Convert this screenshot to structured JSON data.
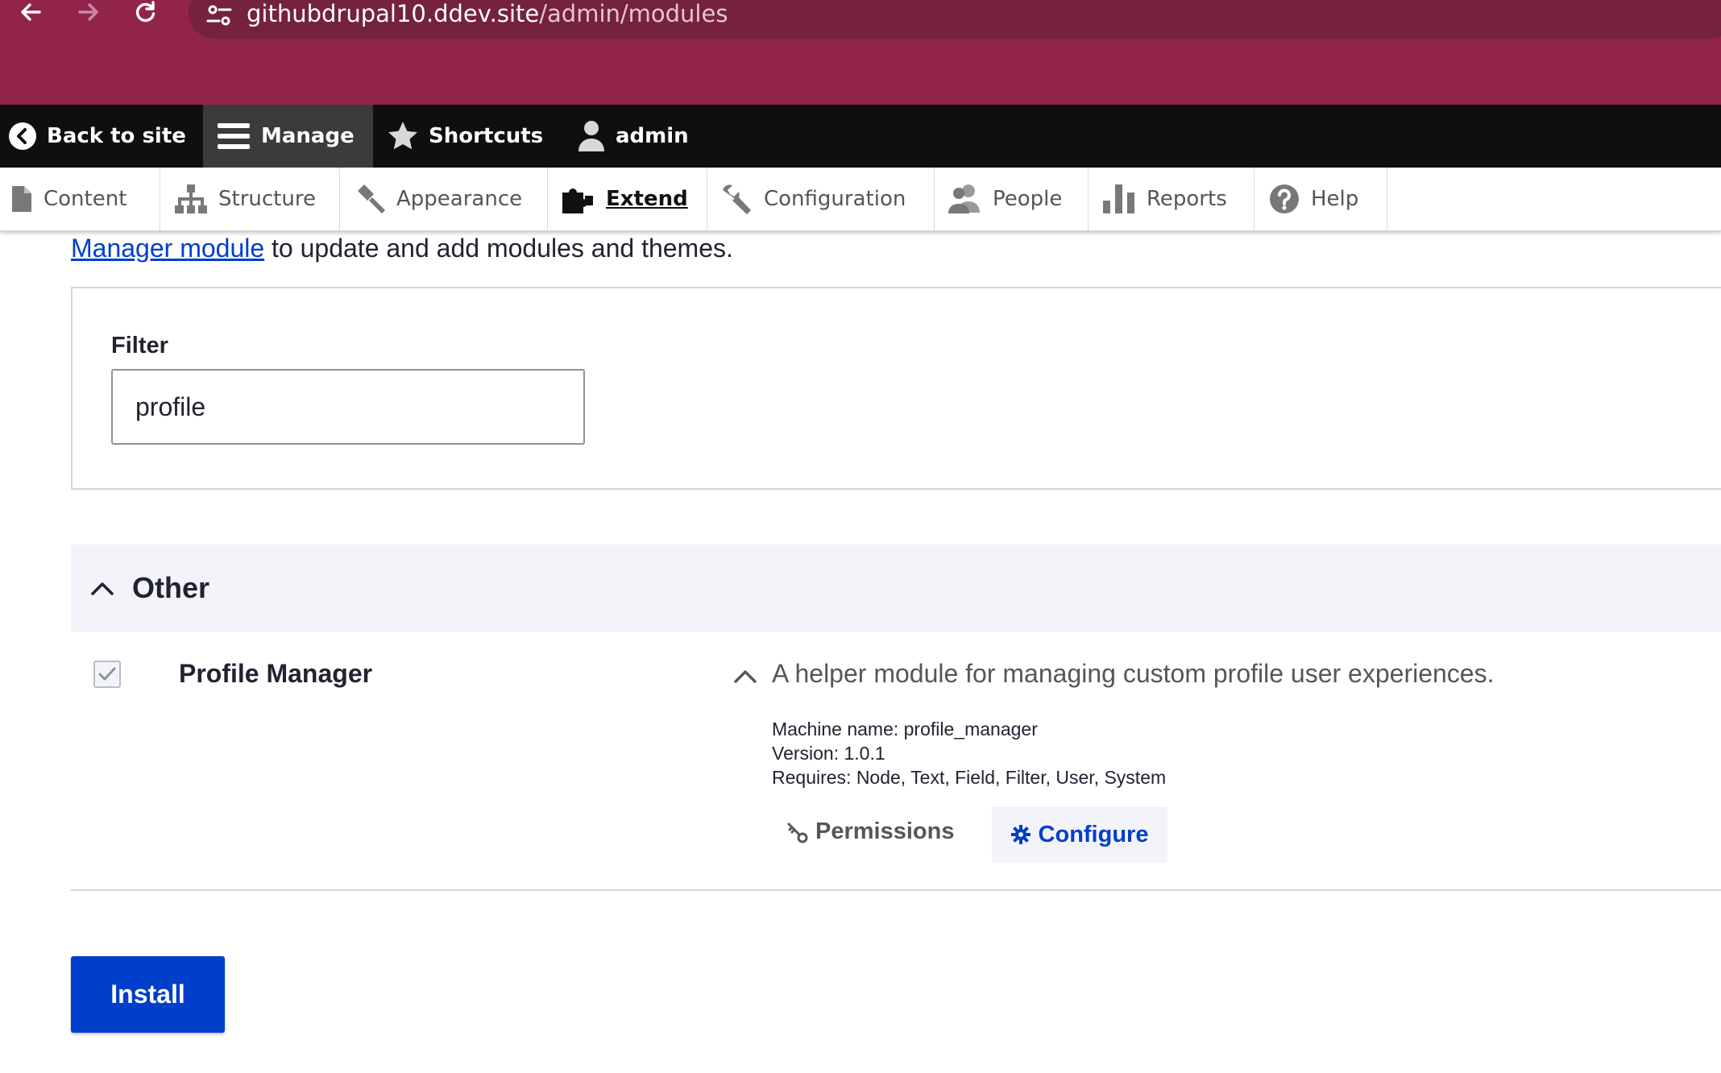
{
  "browser": {
    "url_host": "githubdrupal10.ddev.site",
    "url_path": "/admin/modules",
    "icons": [
      "back-arrow-icon",
      "forward-arrow-icon",
      "reload-icon",
      "site-info-icon"
    ]
  },
  "toolbar": {
    "back_to_site": "Back to site",
    "manage": "Manage",
    "shortcuts": "Shortcuts",
    "user": "admin"
  },
  "tray": {
    "items": [
      "Content",
      "Structure",
      "Appearance",
      "Extend",
      "Configuration",
      "People",
      "Reports",
      "Help"
    ],
    "active": "Extend"
  },
  "intro": {
    "link_text": "Manager module",
    "text": " to update and add modules and themes."
  },
  "filter": {
    "label": "Filter",
    "value": "profile"
  },
  "package": {
    "title": "Other"
  },
  "module": {
    "name": "Profile Manager",
    "checked": true,
    "description": "A helper module for managing custom profile user experiences.",
    "machine_name": "Machine name: profile_manager",
    "version": "Version: 1.0.1",
    "requires": "Requires: Node, Text, Field, Filter, User, System",
    "permissions_label": "Permissions",
    "configure_label": "Configure"
  },
  "actions": {
    "install_label": "Install"
  },
  "colors": {
    "chrome": "#92244c",
    "toolbar": "#0f0f0f",
    "accent": "#003ecc"
  }
}
